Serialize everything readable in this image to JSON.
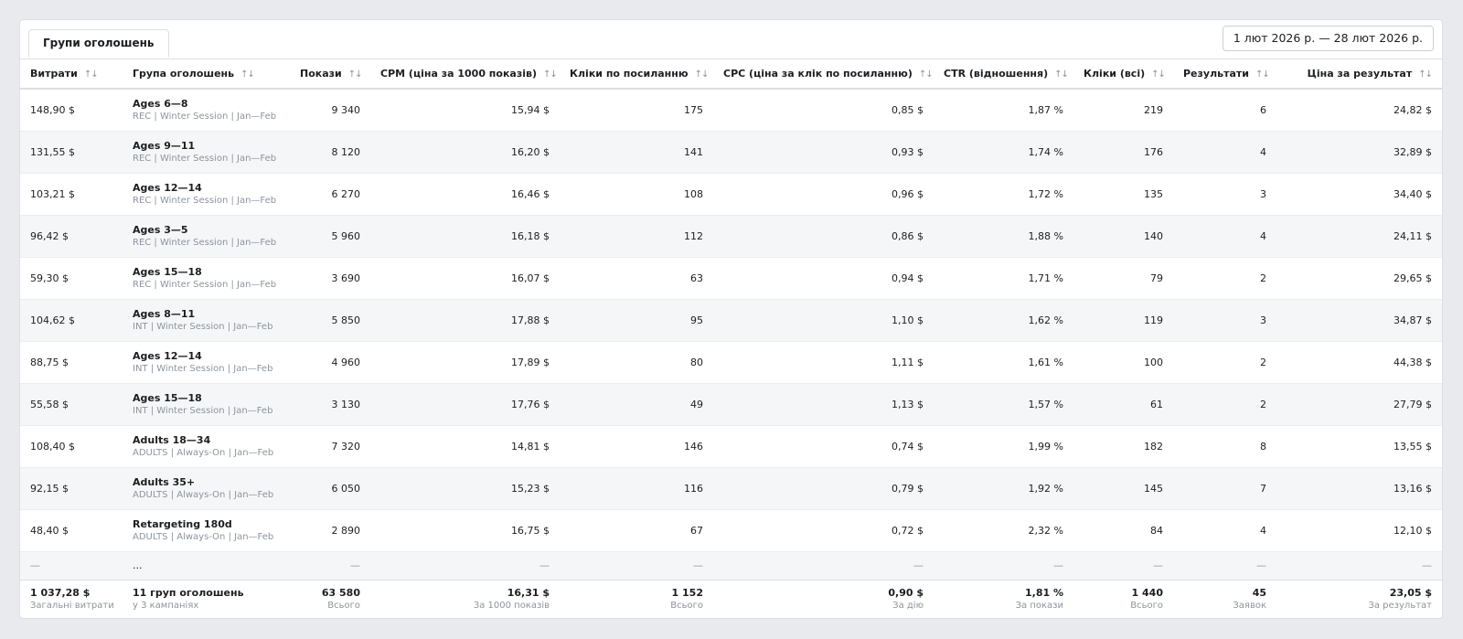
{
  "tab_label": "Групи оголошень",
  "date_range": "1 лют 2026 р. — 28 лют 2026 р.",
  "sort_glyph": "↑↓",
  "columns": [
    {
      "label": "Витрати",
      "align": "l"
    },
    {
      "label": "Група оголошень",
      "align": "l"
    },
    {
      "label": "Покази",
      "align": "r"
    },
    {
      "label": "CPM (ціна за 1000 показів)",
      "align": "r"
    },
    {
      "label": "Кліки по посиланню",
      "align": "r"
    },
    {
      "label": "CPC (ціна за клік по посиланню)",
      "align": "r"
    },
    {
      "label": "CTR (відношення)",
      "align": "r"
    },
    {
      "label": "Кліки (всі)",
      "align": "r"
    },
    {
      "label": "Результати",
      "align": "r"
    },
    {
      "label": "Ціна за результат",
      "align": "r"
    }
  ],
  "rows": [
    {
      "spend": "148,90 $",
      "name": "Ages 6—8",
      "campaign": "REC | Winter Session | Jan—Feb",
      "impressions": "9 340",
      "cpm": "15,94 $",
      "link_clicks": "175",
      "cpc": "0,85 $",
      "ctr": "1,87 %",
      "clicks_all": "219",
      "results": "6",
      "cost_per_result": "24,82 $"
    },
    {
      "spend": "131,55 $",
      "name": "Ages 9—11",
      "campaign": "REC | Winter Session | Jan—Feb",
      "impressions": "8 120",
      "cpm": "16,20 $",
      "link_clicks": "141",
      "cpc": "0,93 $",
      "ctr": "1,74 %",
      "clicks_all": "176",
      "results": "4",
      "cost_per_result": "32,89 $"
    },
    {
      "spend": "103,21 $",
      "name": "Ages 12—14",
      "campaign": "REC | Winter Session | Jan—Feb",
      "impressions": "6 270",
      "cpm": "16,46 $",
      "link_clicks": "108",
      "cpc": "0,96 $",
      "ctr": "1,72 %",
      "clicks_all": "135",
      "results": "3",
      "cost_per_result": "34,40 $"
    },
    {
      "spend": "96,42 $",
      "name": "Ages 3—5",
      "campaign": "REC | Winter Session | Jan—Feb",
      "impressions": "5 960",
      "cpm": "16,18 $",
      "link_clicks": "112",
      "cpc": "0,86 $",
      "ctr": "1,88 %",
      "clicks_all": "140",
      "results": "4",
      "cost_per_result": "24,11 $"
    },
    {
      "spend": "59,30 $",
      "name": "Ages 15—18",
      "campaign": "REC | Winter Session | Jan—Feb",
      "impressions": "3 690",
      "cpm": "16,07 $",
      "link_clicks": "63",
      "cpc": "0,94 $",
      "ctr": "1,71 %",
      "clicks_all": "79",
      "results": "2",
      "cost_per_result": "29,65 $"
    },
    {
      "spend": "104,62 $",
      "name": "Ages 8—11",
      "campaign": "INT | Winter Session | Jan—Feb",
      "impressions": "5 850",
      "cpm": "17,88 $",
      "link_clicks": "95",
      "cpc": "1,10 $",
      "ctr": "1,62 %",
      "clicks_all": "119",
      "results": "3",
      "cost_per_result": "34,87 $"
    },
    {
      "spend": "88,75 $",
      "name": "Ages 12—14",
      "campaign": "INT | Winter Session | Jan—Feb",
      "impressions": "4 960",
      "cpm": "17,89 $",
      "link_clicks": "80",
      "cpc": "1,11 $",
      "ctr": "1,61 %",
      "clicks_all": "100",
      "results": "2",
      "cost_per_result": "44,38 $"
    },
    {
      "spend": "55,58 $",
      "name": "Ages 15—18",
      "campaign": "INT | Winter Session | Jan—Feb",
      "impressions": "3 130",
      "cpm": "17,76 $",
      "link_clicks": "49",
      "cpc": "1,13 $",
      "ctr": "1,57 %",
      "clicks_all": "61",
      "results": "2",
      "cost_per_result": "27,79 $"
    },
    {
      "spend": "108,40 $",
      "name": "Adults 18—34",
      "campaign": "ADULTS | Always-On | Jan—Feb",
      "impressions": "7 320",
      "cpm": "14,81 $",
      "link_clicks": "146",
      "cpc": "0,74 $",
      "ctr": "1,99 %",
      "clicks_all": "182",
      "results": "8",
      "cost_per_result": "13,55 $"
    },
    {
      "spend": "92,15 $",
      "name": "Adults 35+",
      "campaign": "ADULTS | Always-On | Jan—Feb",
      "impressions": "6 050",
      "cpm": "15,23 $",
      "link_clicks": "116",
      "cpc": "0,79 $",
      "ctr": "1,92 %",
      "clicks_all": "145",
      "results": "7",
      "cost_per_result": "13,16 $"
    },
    {
      "spend": "48,40 $",
      "name": "Retargeting 180d",
      "campaign": "ADULTS | Always-On | Jan—Feb",
      "impressions": "2 890",
      "cpm": "16,75 $",
      "link_clicks": "67",
      "cpc": "0,72 $",
      "ctr": "2,32 %",
      "clicks_all": "84",
      "results": "4",
      "cost_per_result": "12,10 $"
    }
  ],
  "ellipsis_row": {
    "dash": "—",
    "dots": "..."
  },
  "totals": [
    {
      "value": "1 037,28 $",
      "label": "Загальні витрати",
      "align": "l"
    },
    {
      "value": "11 груп оголошень",
      "label": "у 3 кампаніях",
      "align": "l"
    },
    {
      "value": "63 580",
      "label": "Всього",
      "align": "r"
    },
    {
      "value": "16,31 $",
      "label": "За 1000 показів",
      "align": "r"
    },
    {
      "value": "1 152",
      "label": "Всього",
      "align": "r"
    },
    {
      "value": "0,90 $",
      "label": "За дію",
      "align": "r"
    },
    {
      "value": "1,81 %",
      "label": "За покази",
      "align": "r"
    },
    {
      "value": "1 440",
      "label": "Всього",
      "align": "r"
    },
    {
      "value": "45",
      "label": "Заявок",
      "align": "r"
    },
    {
      "value": "23,05 $",
      "label": "За результат",
      "align": "r"
    }
  ]
}
